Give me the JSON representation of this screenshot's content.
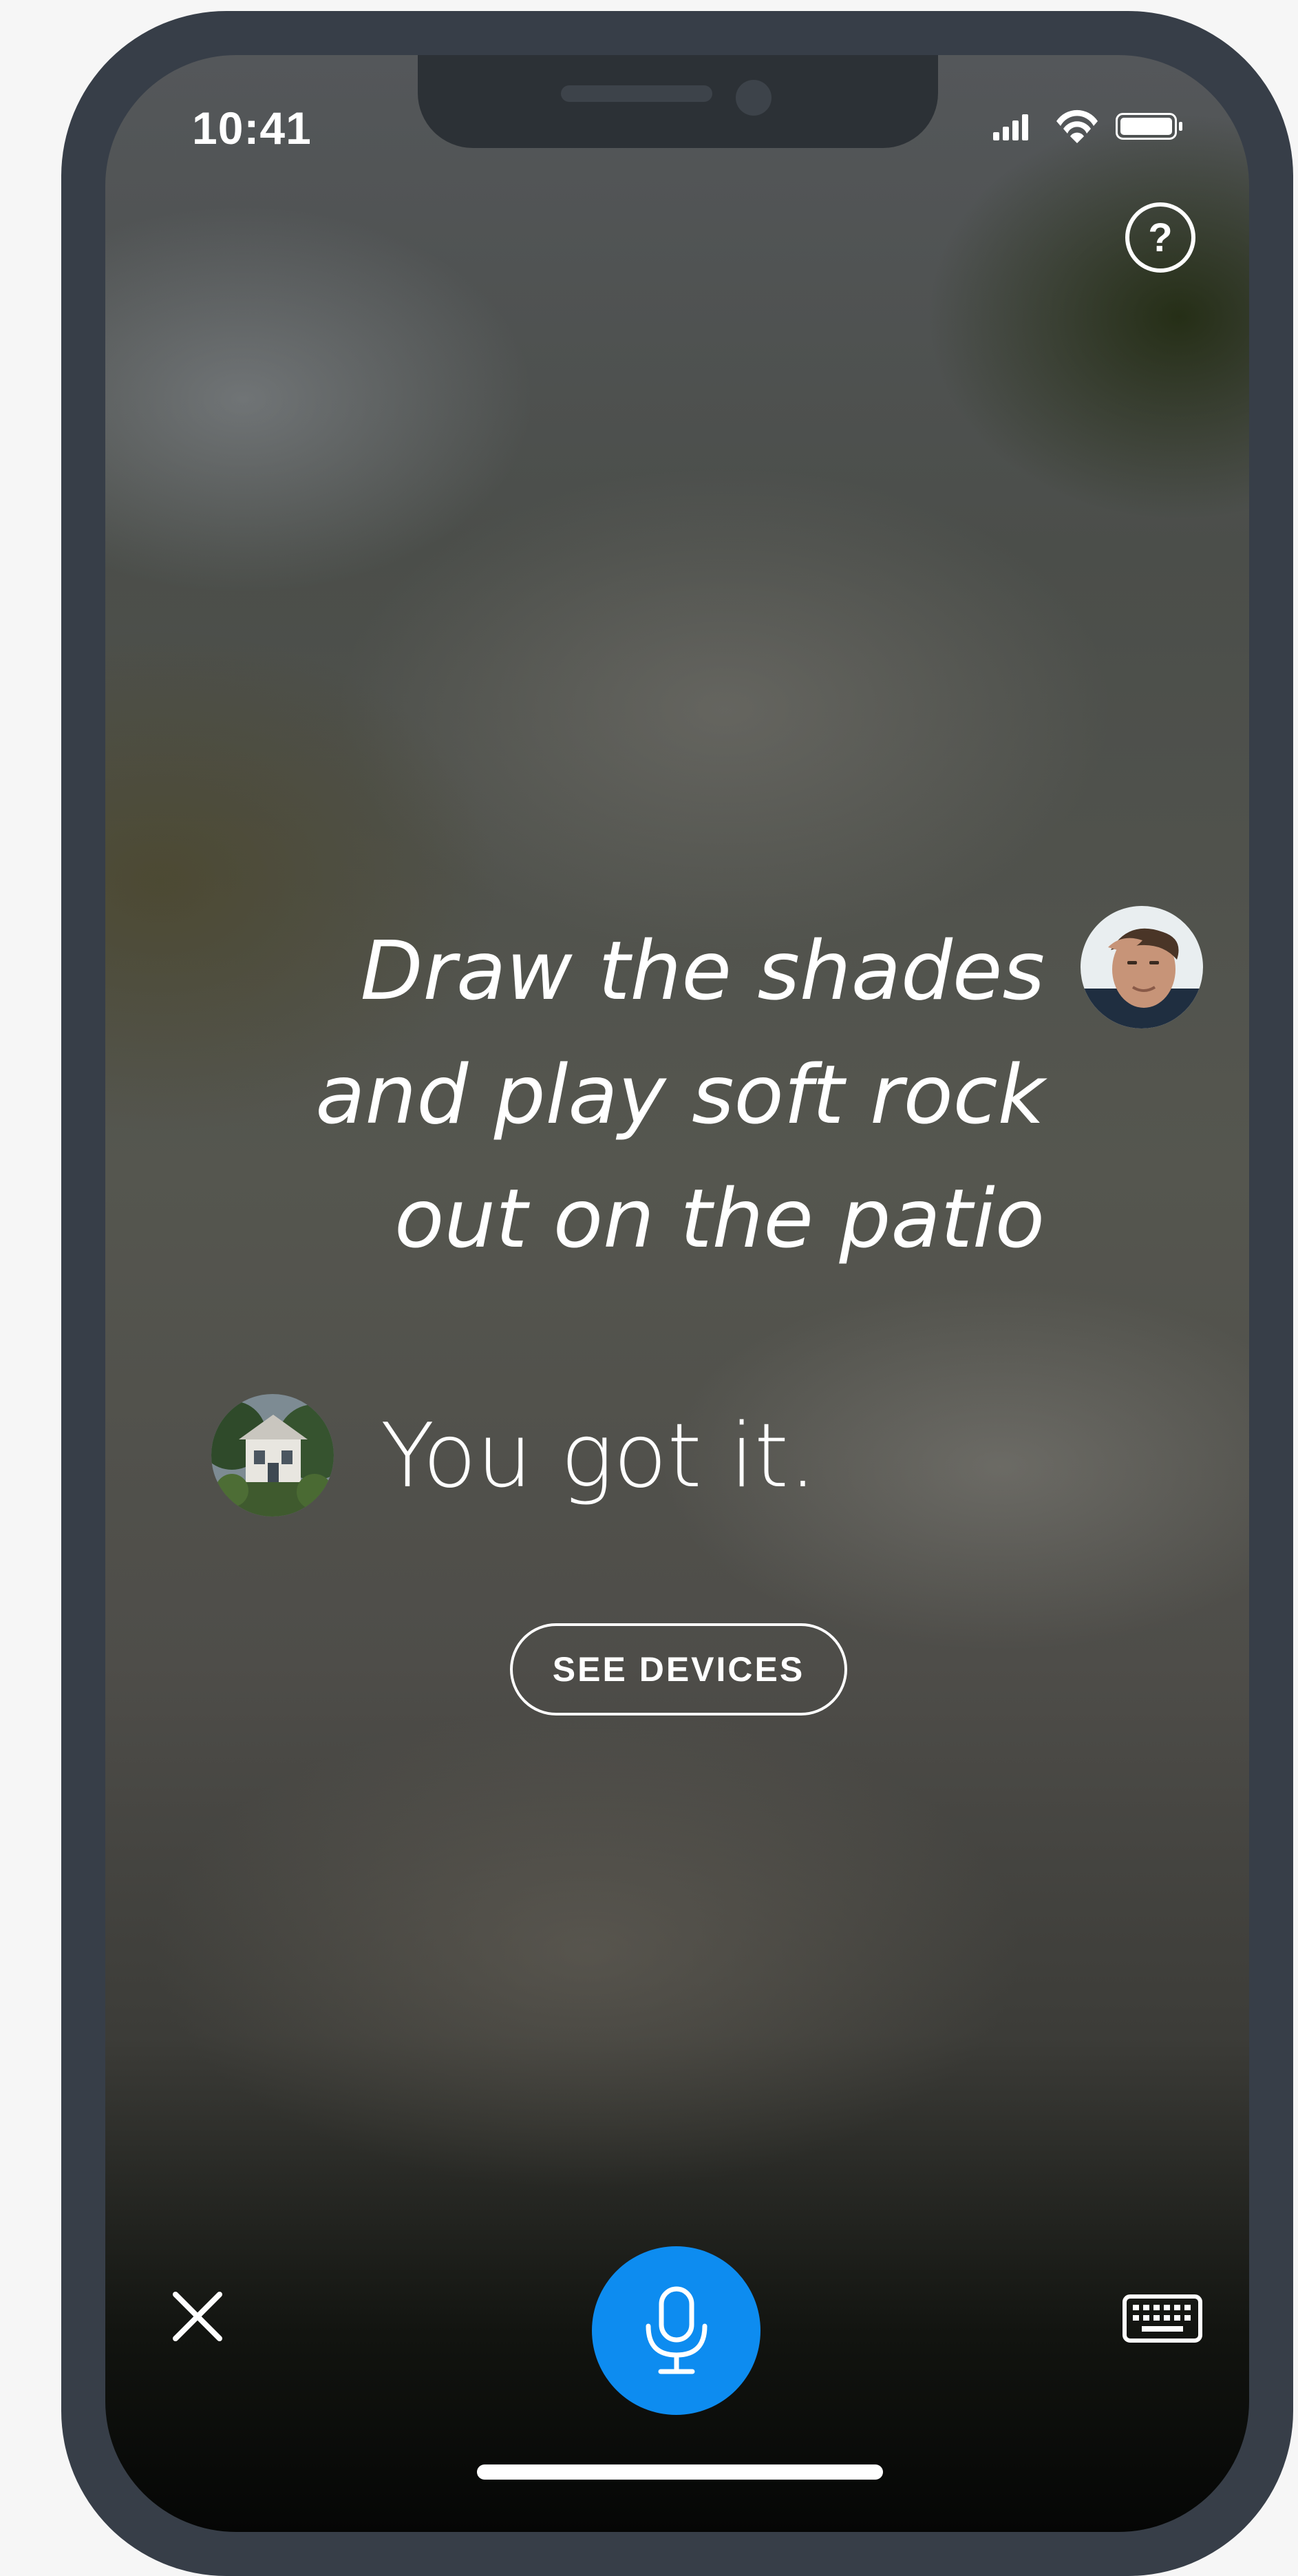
{
  "status_bar": {
    "time": "10:41",
    "icons": [
      "signal-icon",
      "wifi-icon",
      "battery-icon"
    ]
  },
  "help": {
    "label": "?",
    "icon": "help-circle-icon"
  },
  "conversation": {
    "user_message": "Draw the shades and play soft rock out on the patio",
    "assistant_message": "You got it."
  },
  "actions": {
    "see_devices_label": "SEE DEVICES"
  },
  "bottom_bar": {
    "close_icon": "close-icon",
    "mic_icon": "microphone-icon",
    "keyboard_icon": "keyboard-icon"
  },
  "colors": {
    "frame": "#373e48",
    "mic_button": "#0d8cf0",
    "text": "#ffffff"
  }
}
